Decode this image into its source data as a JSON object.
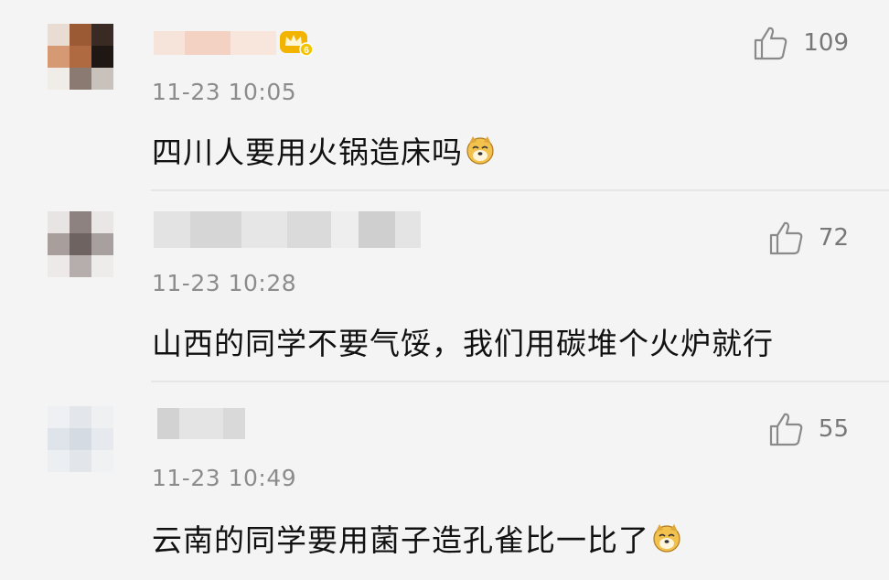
{
  "comments": [
    {
      "time": "11-23 10:05",
      "text": "四川人要用火锅造床吗",
      "likes": "109",
      "has_vip_badge": true,
      "has_emoji": true,
      "emoji": "dog-emoji"
    },
    {
      "time": "11-23 10:28",
      "text": "山西的同学不要气馁，我们用碳堆个火炉就行",
      "likes": "72",
      "has_vip_badge": false,
      "has_emoji": false
    },
    {
      "time": "11-23 10:49",
      "text": "云南的同学要用菌子造孔雀比一比了",
      "likes": "55",
      "has_vip_badge": false,
      "has_emoji": true,
      "emoji": "dog-emoji"
    }
  ],
  "colors": {
    "background": "#f4f4f4",
    "divider": "#e6e6e6",
    "time_text": "#8c8c8c",
    "like_count": "#777777"
  },
  "icons": {
    "like": "thumbs-up-icon",
    "emoji": "dog-emoji",
    "badge": "vip-crown-icon"
  }
}
